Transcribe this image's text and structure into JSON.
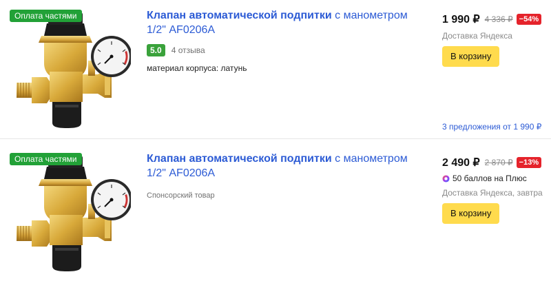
{
  "products": [
    {
      "badge": "Оплата частями",
      "title_bold": "Клапан автоматической подпитки",
      "title_rest": " с манометром 1/2\" AF0206A",
      "rating": "5.0",
      "reviews": "4 отзыва",
      "spec": "материал корпуса: латунь",
      "price": "1 990 ₽",
      "old_price": "4 336 ₽",
      "discount": "−54%",
      "delivery": "Доставка Яндекса",
      "cart_label": "В корзину",
      "offers": "3 предложения от 1 990 ₽"
    },
    {
      "badge": "Оплата частями",
      "title_bold": "Клапан автоматической подпитки",
      "title_rest": " с манометром 1/2\" AF0206A",
      "sponsored": "Спонсорский товар",
      "price": "2 490 ₽",
      "old_price": "2 870 ₽",
      "discount": "−13%",
      "plus_points": "50 баллов на Плюс",
      "delivery": "Доставка Яндекса, завтра",
      "cart_label": "В корзину"
    }
  ],
  "colors": {
    "link": "#2c5bd5",
    "installment_badge": "#22a137",
    "rating_chip": "#3aa23b",
    "discount": "#e5232b",
    "cart_button": "#ffdb4d",
    "brass": "#d8a93a"
  },
  "icons": [
    "valve-product-image",
    "plus-points-icon"
  ]
}
